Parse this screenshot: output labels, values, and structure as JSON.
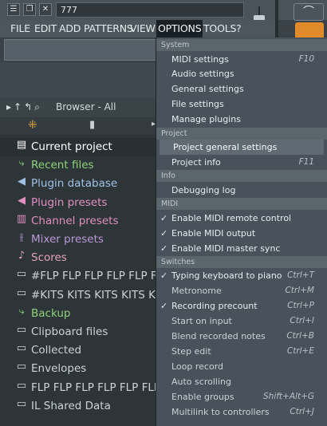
{
  "window": {
    "title_value": "777",
    "buttons": {
      "menu": "☰",
      "restore": "❐",
      "close": "✕"
    }
  },
  "menubar": [
    "FILE",
    "EDIT",
    "ADD",
    "PATTERNS",
    "VIEW",
    "OPTIONS",
    "TOOLS",
    "?"
  ],
  "browser": {
    "title": "Browser - All",
    "items": [
      {
        "label": "Current project",
        "icon": "document-icon",
        "color": "#ffffff"
      },
      {
        "label": "Recent files",
        "icon": "folder-arrow-icon",
        "color": "#8fd27a"
      },
      {
        "label": "Plugin database",
        "icon": "speaker-icon",
        "color": "#9fc1e3"
      },
      {
        "label": "Plugin presets",
        "icon": "speaker-icon",
        "color": "#e08fbf"
      },
      {
        "label": "Channel presets",
        "icon": "channel-icon",
        "color": "#e08fbf"
      },
      {
        "label": "Mixer presets",
        "icon": "mixer-icon",
        "color": "#b99ad6"
      },
      {
        "label": "Scores",
        "icon": "note-icon",
        "color": "#e3a3b5"
      },
      {
        "label": "#FLP FLP FLP FLP FLP FLP FLP",
        "icon": "folder-icon",
        "color": "#cbd3d8"
      },
      {
        "label": "#KITS KITS KITS KITS KITS",
        "icon": "folder-icon",
        "color": "#cbd3d8"
      },
      {
        "label": "Backup",
        "icon": "folder-arrow-icon",
        "color": "#8fd27a"
      },
      {
        "label": "Clipboard files",
        "icon": "folder-icon",
        "color": "#cbd3d8"
      },
      {
        "label": "Collected",
        "icon": "folder-icon",
        "color": "#cbd3d8"
      },
      {
        "label": "Envelopes",
        "icon": "folder-icon",
        "color": "#cbd3d8"
      },
      {
        "label": "FLP FLP FLP FLP FLP FLP FLP",
        "icon": "folder-icon",
        "color": "#cbd3d8"
      },
      {
        "label": "IL Shared Data",
        "icon": "folder-icon",
        "color": "#cbd3d8"
      }
    ]
  },
  "dropdown": {
    "sections": [
      {
        "header": "System",
        "items": [
          {
            "label": "MIDI settings",
            "shortcut": "F10"
          },
          {
            "label": "Audio settings",
            "shortcut": ""
          },
          {
            "label": "General settings",
            "shortcut": ""
          },
          {
            "label": "File settings",
            "shortcut": ""
          },
          {
            "label": "Manage plugins",
            "shortcut": ""
          }
        ]
      },
      {
        "header": "Project",
        "items": [
          {
            "label": "Project general settings",
            "shortcut": "",
            "highlight": true
          },
          {
            "label": "Project info",
            "shortcut": "F11"
          }
        ]
      },
      {
        "header": "Info",
        "items": [
          {
            "label": "Debugging log",
            "shortcut": ""
          }
        ]
      },
      {
        "header": "MIDI",
        "items": [
          {
            "label": "Enable MIDI remote control",
            "shortcut": "",
            "checked": true
          },
          {
            "label": "Enable MIDI output",
            "shortcut": "",
            "checked": true
          },
          {
            "label": "Enable MIDI master sync",
            "shortcut": "",
            "checked": true
          }
        ]
      },
      {
        "header": "Switches",
        "items": [
          {
            "label": "Typing keyboard to piano",
            "shortcut": "Ctrl+T",
            "checked": true
          },
          {
            "label": "Metronome",
            "shortcut": "Ctrl+M",
            "checked": false
          },
          {
            "label": "Recording precount",
            "shortcut": "Ctrl+P",
            "checked": true
          },
          {
            "label": "Start on input",
            "shortcut": "Ctrl+I",
            "checked": false
          },
          {
            "label": "Blend recorded notes",
            "shortcut": "Ctrl+B",
            "checked": false
          },
          {
            "label": "Step edit",
            "shortcut": "Ctrl+E",
            "checked": false
          },
          {
            "label": "Loop record",
            "shortcut": "",
            "checked": false
          },
          {
            "label": "Auto scrolling",
            "shortcut": "",
            "checked": false
          },
          {
            "label": "Enable groups",
            "shortcut": "Shift+Alt+G",
            "checked": false
          },
          {
            "label": "Multilink to controllers",
            "shortcut": "Ctrl+J",
            "checked": false
          }
        ]
      }
    ]
  }
}
